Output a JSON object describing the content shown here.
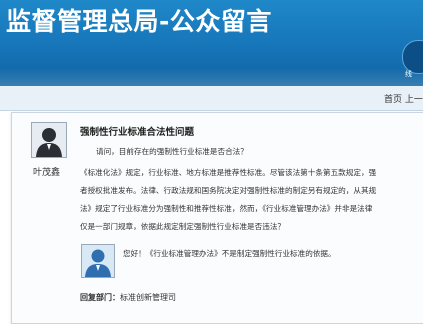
{
  "header": {
    "title": "监督管理总局-公众留言",
    "corner_label": "线"
  },
  "nav": {
    "links": "首页 上一"
  },
  "question": {
    "asker_name": "叶茂鑫",
    "title": "强制性行业标准合法性问题",
    "lines": [
      "请问，目前存在的强制性行业标准是否合法？",
      "《标准化法》规定，行业标准、地方标准是推荐性标准。尽管该法第十条第五款规定，强",
      "者授权批准发布。法律、行政法规和国务院决定对强制性标准的制定另有规定的，从其规",
      "法》规定了行业标准分为强制性和推荐性标准，然而，《行业标准管理办法》并非是法律",
      "仅是一部门规章，依据此规定制定强制性行业标准是否违法？"
    ]
  },
  "reply": {
    "text": "您好！《行业标准管理办法》不是制定强制性行业标准的依据。",
    "dept_label": "回复部门：",
    "dept_name": "标准创新管理司"
  },
  "colors": {
    "header_blue": "#1675b8",
    "nav_bg": "#e8f1f8"
  }
}
